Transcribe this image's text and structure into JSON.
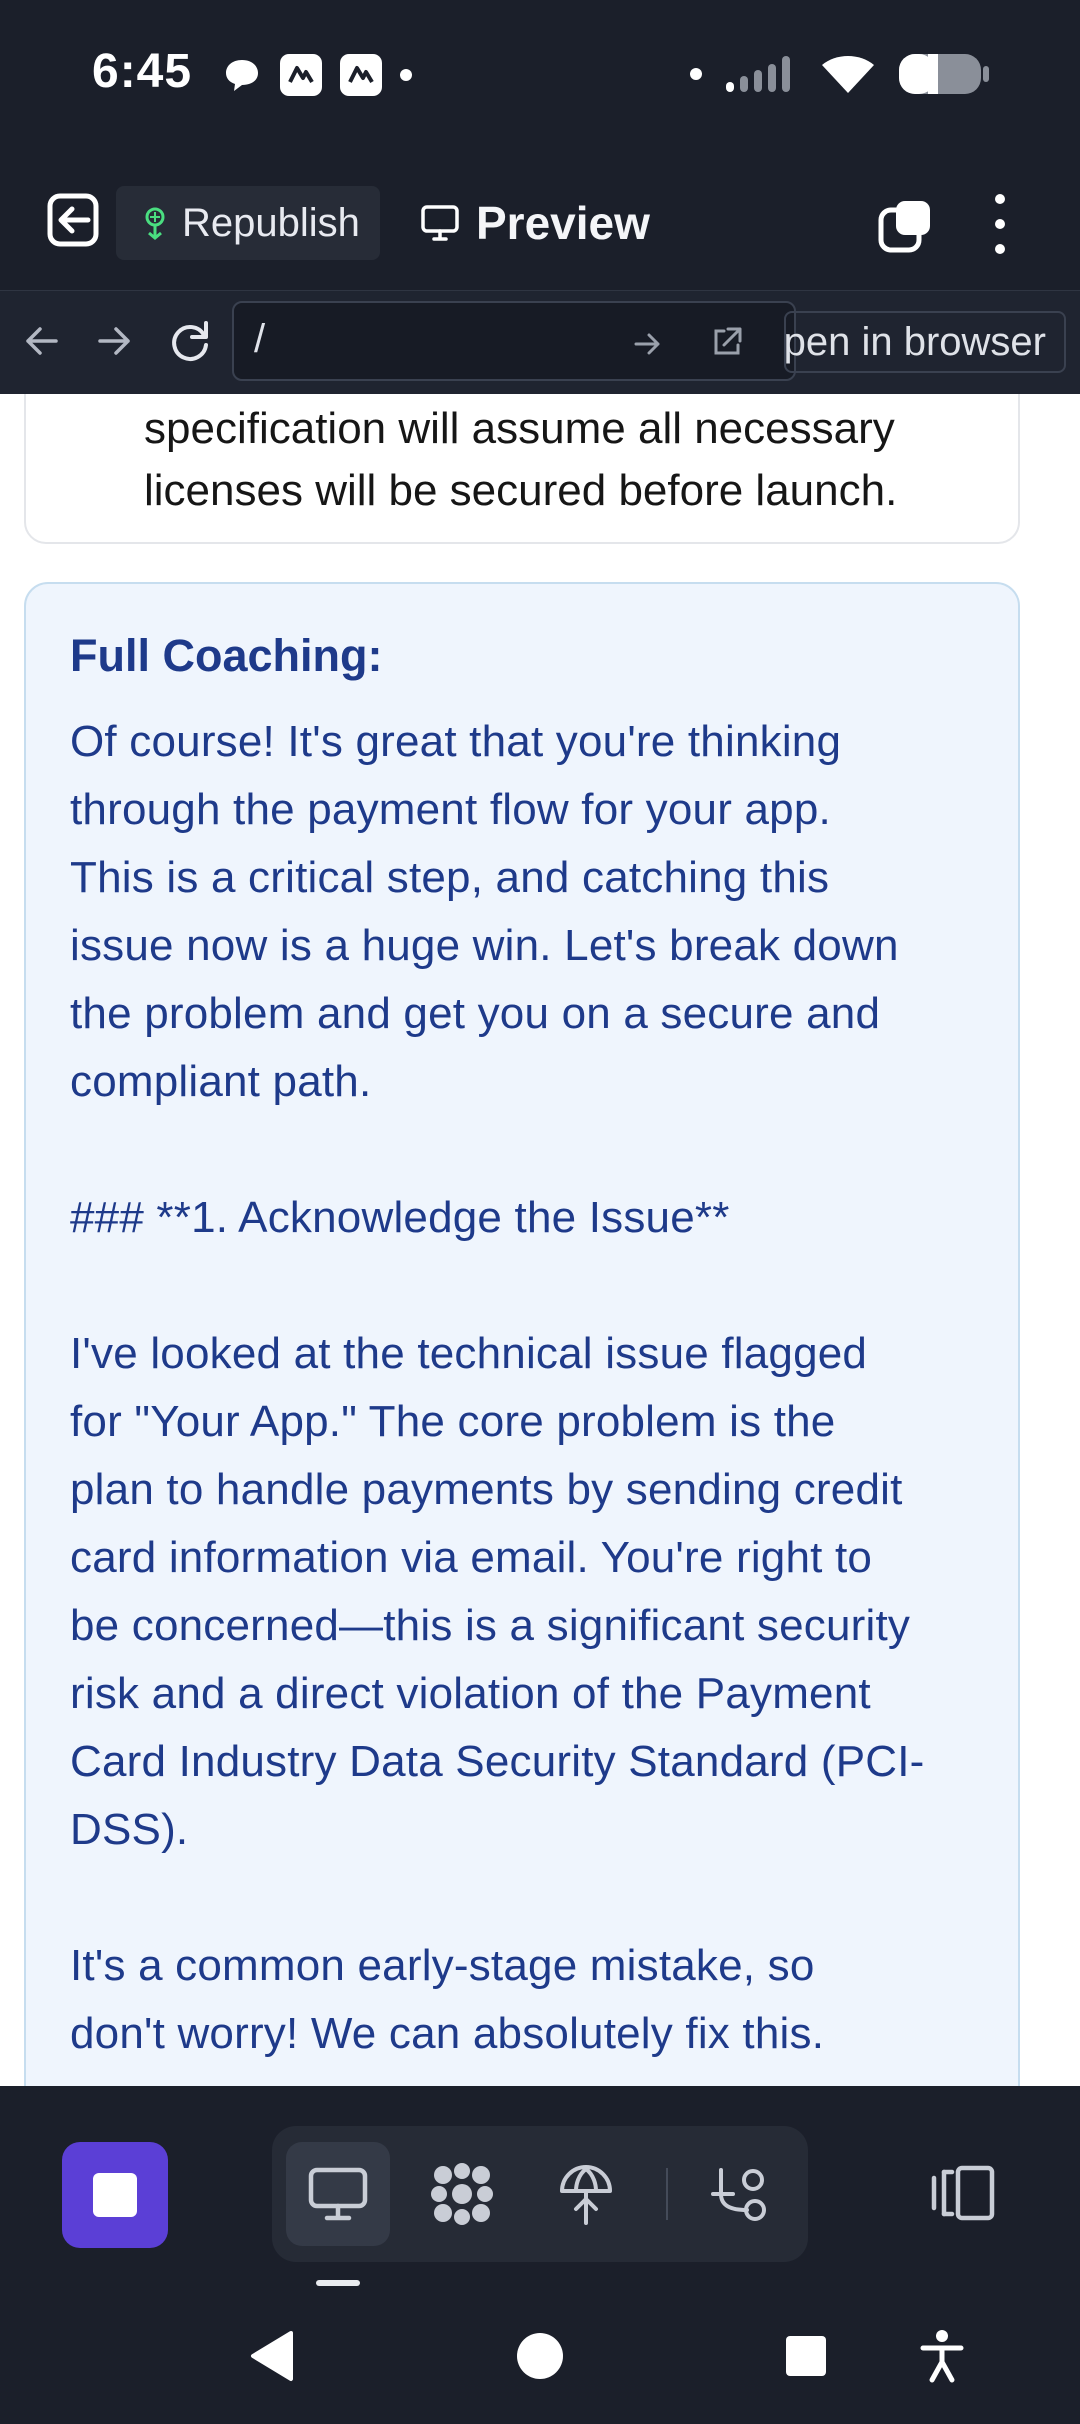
{
  "status_bar": {
    "time": "6:45",
    "notification_icons": [
      "chat-bubble-icon",
      "app-notification-icon",
      "app-notification-icon"
    ],
    "system_icons": [
      "signal-icon",
      "wifi-icon",
      "battery-icon"
    ]
  },
  "toolbar": {
    "republish_label": "Republish",
    "preview_label": "Preview"
  },
  "url_bar": {
    "url": "/",
    "open_in_browser_label": "Open in browser"
  },
  "content": {
    "prev_card_lines": [
      "specification will assume all necessary",
      "licenses will be secured before launch."
    ],
    "coaching_heading": "Full Coaching:",
    "coaching_body": "Of course! It's great that you're thinking\nthrough the payment flow for your app.\nThis is a critical step, and catching this\nissue now is a huge win. Let's break down\nthe problem and get you on a secure and\ncompliant path.\n\n### **1. Acknowledge the Issue**\n\nI've looked at the technical issue flagged\nfor \"Your App.\" The core problem is the\nplan to handle payments by sending credit\ncard information via email. You're right to\nbe concerned—this is a significant security\nrisk and a direct violation of the Payment\nCard Industry Data Security Standard (PCI-\nDSS).\n\nIt's a common early-stage mistake, so\ndon't worry! We can absolutely fix this."
  },
  "bottom_toolbar": {
    "tools": [
      "preview-tool",
      "agent-tool",
      "deploy-tool",
      "git-tool"
    ],
    "accent_color": "#5b3fd6"
  }
}
